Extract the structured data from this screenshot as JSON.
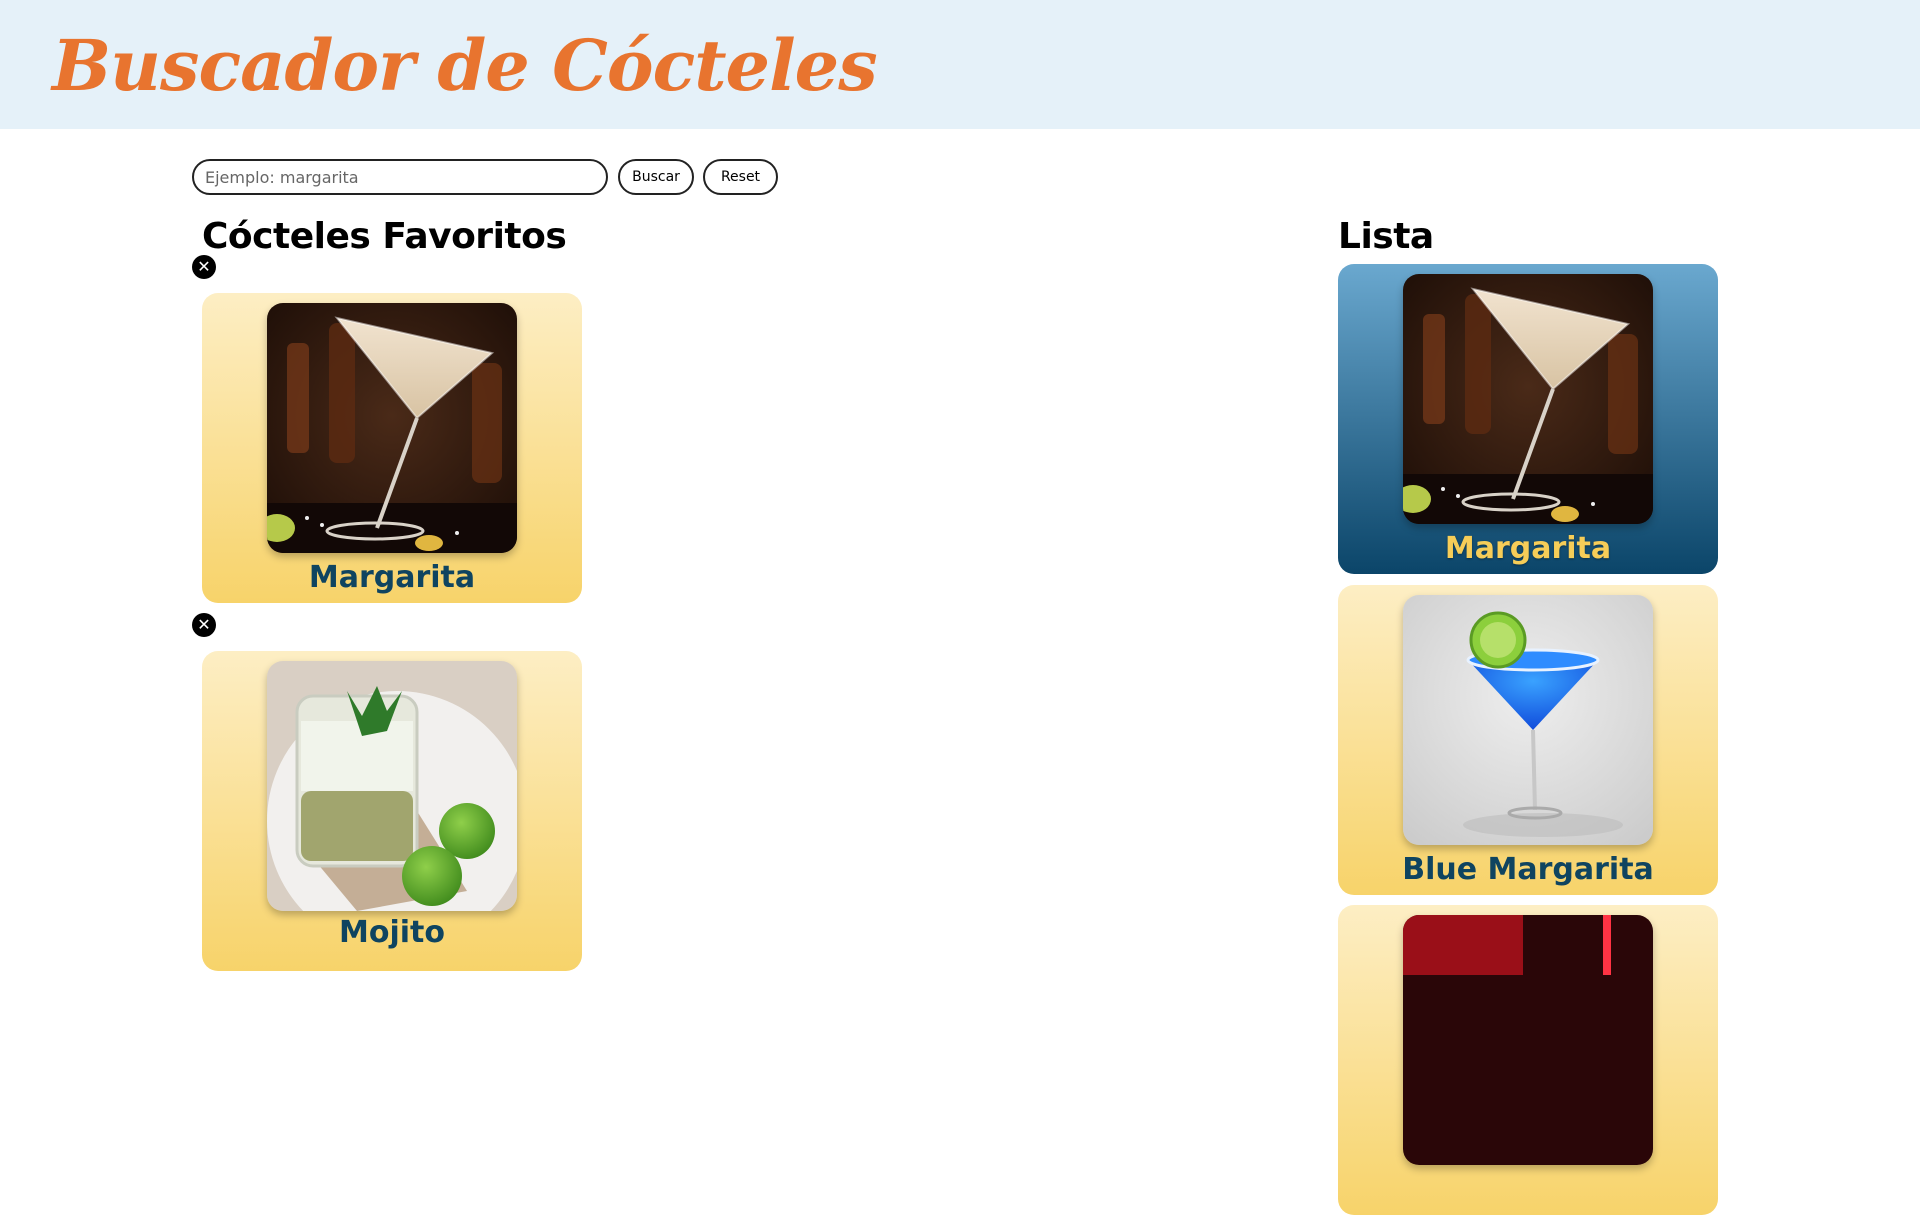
{
  "header": {
    "title": "Buscador de Cócteles"
  },
  "search": {
    "placeholder": "Ejemplo: margarita",
    "value": "",
    "buscar_label": "Buscar",
    "reset_label": "Reset"
  },
  "favorites": {
    "title": "Cócteles Favoritos",
    "remove_glyph": "✕",
    "items": [
      {
        "name": "Margarita"
      },
      {
        "name": "Mojito"
      }
    ]
  },
  "list": {
    "title": "Lista",
    "items": [
      {
        "name": "Margarita"
      },
      {
        "name": "Blue Margarita"
      },
      {
        "name": ""
      }
    ]
  },
  "colors": {
    "header_bg": "#e5f1f9",
    "title_orange": "#e8742f",
    "card_yellow_top": "#fdeec4",
    "card_yellow_bottom": "#f7d36a",
    "card_blue_top": "#6aa8cf",
    "card_blue_bottom": "#0b4569",
    "name_dark_blue": "#0f4460",
    "name_yellow": "#f6cd58"
  }
}
